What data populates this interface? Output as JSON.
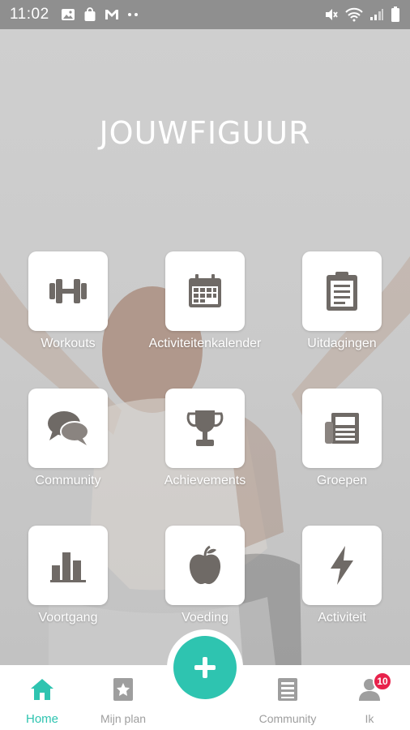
{
  "status_bar": {
    "time": "11:02"
  },
  "logo": {
    "text": "JOUWFIGUUR"
  },
  "tiles": [
    {
      "label": "Workouts",
      "icon": "dumbbell-icon"
    },
    {
      "label": "Activiteitenkalender",
      "icon": "calendar-icon"
    },
    {
      "label": "Uitdagingen",
      "icon": "clipboard-icon"
    },
    {
      "label": "Community",
      "icon": "chat-bubbles-icon"
    },
    {
      "label": "Achievements",
      "icon": "trophy-icon"
    },
    {
      "label": "Groepen",
      "icon": "newspaper-icon"
    },
    {
      "label": "Voortgang",
      "icon": "bar-chart-icon"
    },
    {
      "label": "Voeding",
      "icon": "apple-icon"
    },
    {
      "label": "Activiteit",
      "icon": "lightning-icon"
    }
  ],
  "bottom_nav": {
    "home": "Home",
    "mijn_plan": "Mijn plan",
    "community": "Community",
    "ik": "Ik",
    "ik_badge": "10"
  },
  "colors": {
    "accent": "#2ec4b0",
    "badge": "#e8224b",
    "icon_gray": "#6f6a66"
  }
}
